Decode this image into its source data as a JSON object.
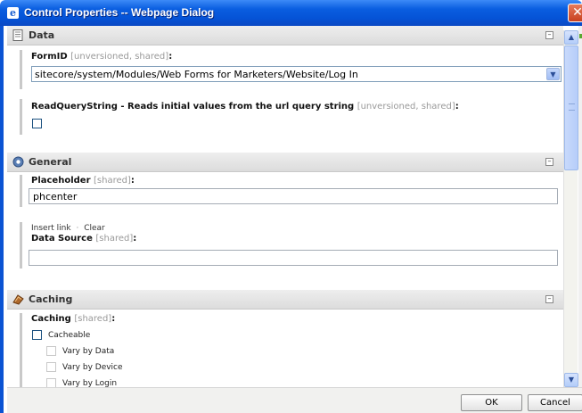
{
  "window": {
    "title": "Control Properties -- Webpage Dialog",
    "close_glyph": "✕",
    "app_icon": "ie-icon"
  },
  "sections": {
    "data": {
      "title": "Data",
      "icon": "data-icon",
      "collapse_glyph": "–",
      "formid": {
        "label": "FormID",
        "meta": "[unversioned, shared]",
        "colon": ":",
        "value": "sitecore/system/Modules/Web Forms for Marketers/Website/Log In"
      },
      "readquerystring": {
        "label": "ReadQueryString - Reads initial values from the url query string",
        "meta": "[unversioned, shared]",
        "colon": ":",
        "checked": false
      }
    },
    "general": {
      "title": "General",
      "icon": "gear-icon",
      "collapse_glyph": "–",
      "placeholder": {
        "label": "Placeholder",
        "meta": "[shared]",
        "colon": ":",
        "value": "phcenter"
      },
      "datasource": {
        "insert_link": "Insert link",
        "separator": "·",
        "clear": "Clear",
        "label": "Data Source",
        "meta": "[shared]",
        "colon": ":",
        "value": ""
      }
    },
    "caching": {
      "title": "Caching",
      "icon": "caching-icon",
      "collapse_glyph": "–",
      "field": {
        "label": "Caching",
        "meta": "[shared]",
        "colon": ":"
      },
      "options": [
        {
          "label": "Cacheable",
          "checked": false
        },
        {
          "label": "Vary by Data",
          "checked": false
        },
        {
          "label": "Vary by Device",
          "checked": false
        },
        {
          "label": "Vary by Login",
          "checked": false
        }
      ]
    }
  },
  "footer": {
    "ok_label": "OK",
    "cancel_label": "Cancel"
  },
  "scrollbar": {
    "up_glyph": "▲",
    "down_glyph": "▼"
  },
  "dropdown_glyph": "▼",
  "colors": {
    "titlebar": "#0a5ee0",
    "section_header": "#e4e4e4",
    "field_border": "#c9c9c9",
    "meta_text": "#999999"
  }
}
